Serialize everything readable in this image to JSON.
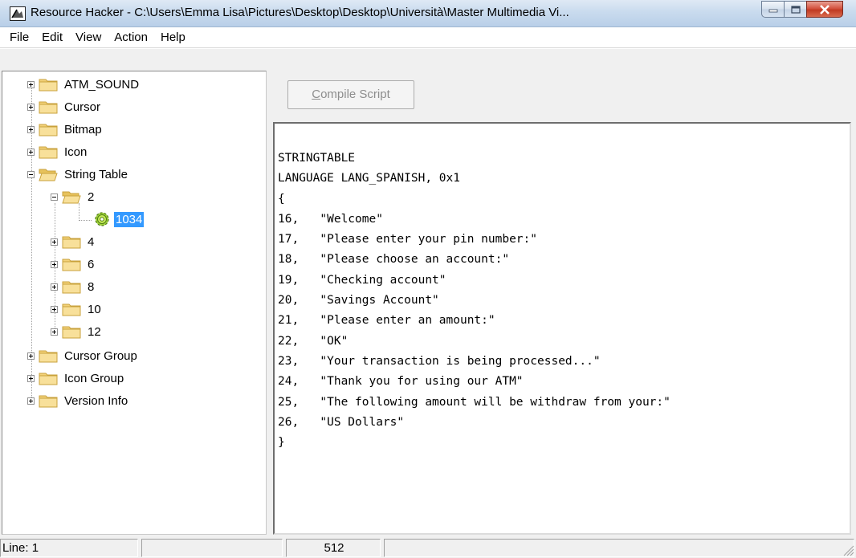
{
  "window": {
    "title": "Resource Hacker  -  C:\\Users\\Emma Lisa\\Pictures\\Desktop\\Desktop\\Università\\Master Multimedia Vi..."
  },
  "menu": [
    "File",
    "Edit",
    "View",
    "Action",
    "Help"
  ],
  "tree": {
    "atm_sound": "ATM_SOUND",
    "cursor": "Cursor",
    "bitmap": "Bitmap",
    "icon": "Icon",
    "string_table": "String Table",
    "st_2": "2",
    "st_2_1034": "1034",
    "st_4": "4",
    "st_6": "6",
    "st_8": "8",
    "st_10": "10",
    "st_12": "12",
    "cursor_group": "Cursor Group",
    "icon_group": "Icon Group",
    "version_info": "Version Info"
  },
  "toolbar": {
    "compile_label_first": "C",
    "compile_label_rest": "ompile Script"
  },
  "editor": {
    "lines": [
      "STRINGTABLE",
      "LANGUAGE LANG_SPANISH, 0x1",
      "{",
      "16,   \"Welcome\"",
      "17,   \"Please enter your pin number:\"",
      "18,   \"Please choose an account:\"",
      "19,   \"Checking account\"",
      "20,   \"Savings Account\"",
      "21,   \"Please enter an amount:\"",
      "22,   \"OK\"",
      "23,   \"Your transaction is being processed...\"",
      "24,   \"Thank you for using our ATM\"",
      "25,   \"The following amount will be withdraw from your:\"",
      "26,   \"US Dollars\"",
      "}"
    ]
  },
  "status": {
    "line": "Line: 1",
    "panel2": "",
    "size": "512"
  },
  "colors": {
    "selection": "#3399ff",
    "folder": "#f5d67a",
    "close_button": "#c9442c"
  }
}
